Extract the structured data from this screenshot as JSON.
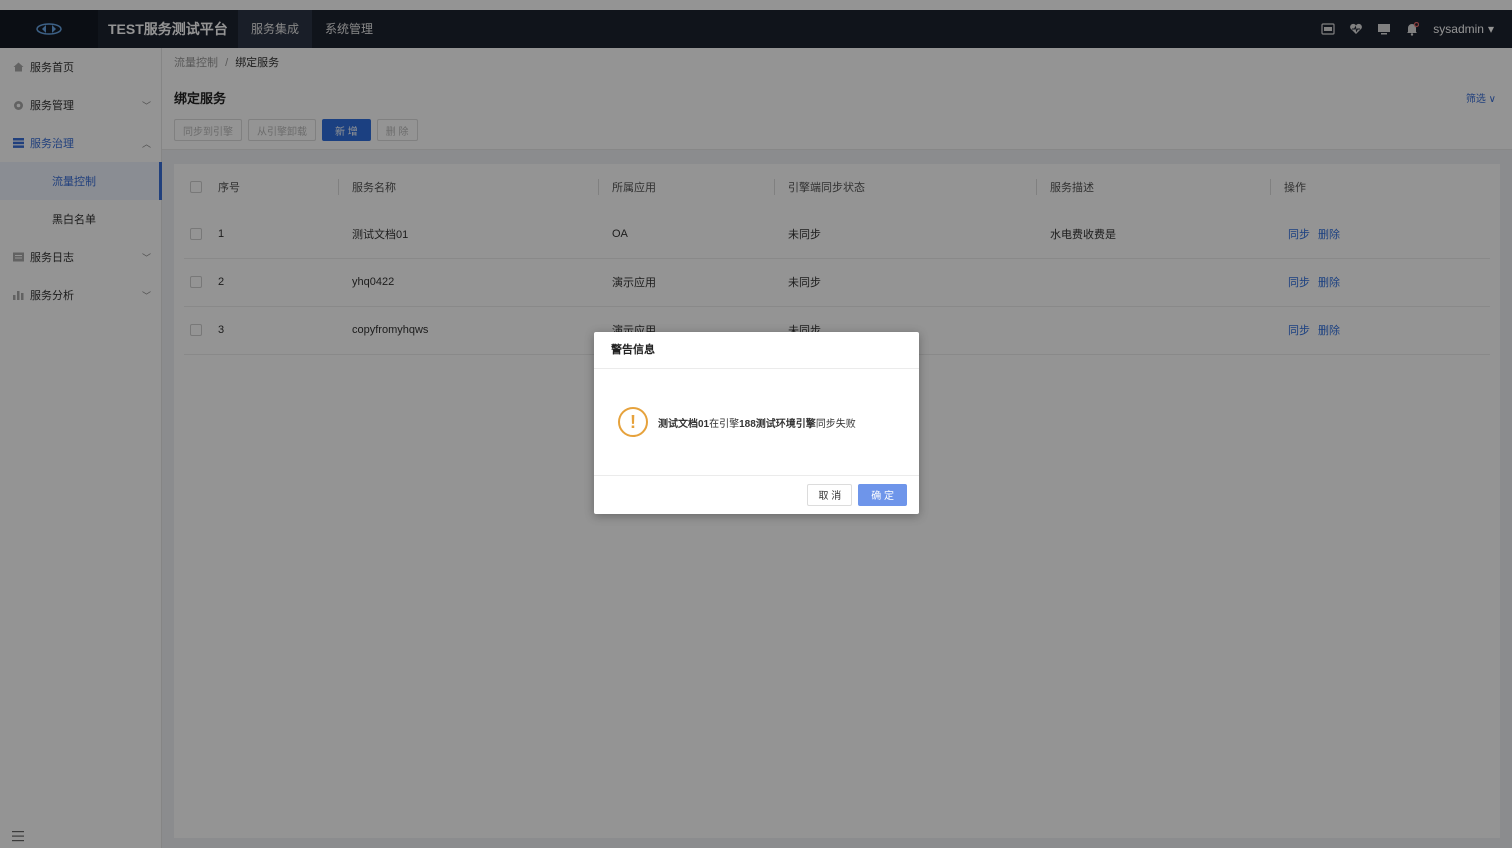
{
  "header": {
    "app_title": "TEST服务测试平台",
    "nav": [
      "服务集成",
      "系统管理"
    ],
    "username": "sysadmin"
  },
  "sidebar": {
    "items": [
      {
        "label": "服务首页",
        "icon": "home-icon"
      },
      {
        "label": "服务管理",
        "icon": "gear-icon"
      },
      {
        "label": "服务治理",
        "icon": "list-icon"
      },
      {
        "label": "服务日志",
        "icon": "log-icon"
      },
      {
        "label": "服务分析",
        "icon": "bar-chart-icon"
      }
    ],
    "sub_items": [
      "流量控制",
      "黑白名单"
    ]
  },
  "breadcrumb": {
    "parent": "流量控制",
    "separator": "/",
    "current": "绑定服务"
  },
  "page": {
    "title": "绑定服务",
    "filter_label": "筛选",
    "buttons": {
      "sync": "同步到引擎",
      "unload": "从引擎卸载",
      "add": "新 增",
      "delete": "删 除"
    }
  },
  "table": {
    "headers": [
      "序号",
      "服务名称",
      "所属应用",
      "引擎端同步状态",
      "服务描述",
      "操作"
    ],
    "rows": [
      {
        "index": "1",
        "name": "测试文档01",
        "app": "OA",
        "status": "未同步",
        "desc": "水电费收费是"
      },
      {
        "index": "2",
        "name": "yhq0422",
        "app": "演示应用",
        "status": "未同步",
        "desc": ""
      },
      {
        "index": "3",
        "name": "copyfromyhqws",
        "app": "演示应用",
        "status": "未同步",
        "desc": ""
      }
    ],
    "op_sync": "同步",
    "op_delete": "删除"
  },
  "dialog": {
    "title": "警告信息",
    "msg_name": "测试文档01",
    "msg_mid": "在引擎",
    "msg_engine": "188测试环境引擎",
    "msg_tail": "同步失败",
    "cancel": "取 消",
    "confirm": "确 定"
  },
  "colors": {
    "accent": "#2f6fde",
    "topbar": "#1d2330",
    "warning": "#e6a23c"
  }
}
